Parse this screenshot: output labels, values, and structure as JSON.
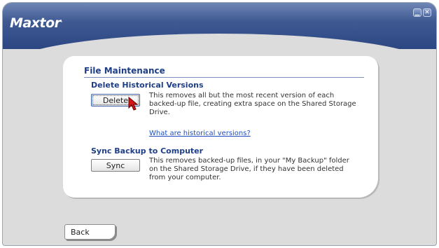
{
  "app": {
    "logo_text": "Maxtor",
    "logo_mark": "."
  },
  "window_controls": {
    "minimize_icon": "minimize-icon",
    "close_icon": "close-icon"
  },
  "panel": {
    "title": "File Maintenance",
    "sections": [
      {
        "title": "Delete Historical Versions",
        "button_label": "Delete",
        "description": "This removes all but the most recent version of each backed-up file, creating extra space on the Shared Storage Drive.",
        "link_text": "What are historical versions?"
      },
      {
        "title": "Sync Backup to Computer",
        "button_label": "Sync",
        "description": "This removes backed-up files, in your \"My Backup\" folder on the Shared Storage Drive, if they have been deleted from your computer."
      }
    ]
  },
  "footer": {
    "back_label": "Back"
  },
  "colors": {
    "title_blue": "#1e3e87",
    "link_blue": "#1f4fc0",
    "frame_blue": "#3f5a93"
  }
}
